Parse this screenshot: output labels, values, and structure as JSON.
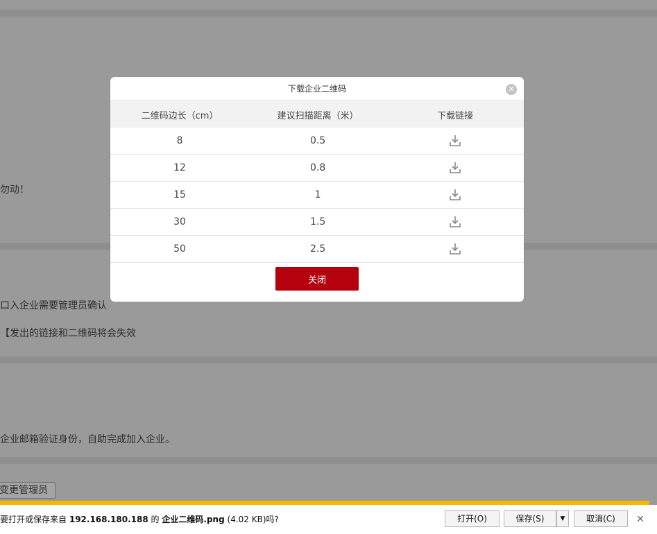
{
  "background": {
    "text_notice": "勿动！",
    "text_confirm": "口入企业需要管理员确认",
    "text_invalid": "【发出的链接和二维码将会失效",
    "text_email": "企业邮箱验证身份，自助完成加入企业。",
    "change_admin_button": "变更管理员"
  },
  "modal": {
    "title": "下载企业二维码",
    "close_icon": "close-circle-icon",
    "headers": [
      "二维码边长（cm）",
      "建议扫描距离（米）",
      "下载链接"
    ],
    "rows": [
      {
        "size": "8",
        "distance": "0.5"
      },
      {
        "size": "12",
        "distance": "0.8"
      },
      {
        "size": "15",
        "distance": "1"
      },
      {
        "size": "30",
        "distance": "1.5"
      },
      {
        "size": "50",
        "distance": "2.5"
      }
    ],
    "download_icon": "download-icon",
    "close_button": "关闭"
  },
  "download_bar": {
    "msg_prefix": "要打开或保存来自",
    "host": "192.168.180.188",
    "msg_mid": "的",
    "filename": "企业二维码.png",
    "size": "(4.02 KB)",
    "msg_suffix": "吗?",
    "open_button": "打开(O)",
    "save_button": "保存(S)",
    "cancel_button": "取消(C)",
    "dropdown_icon": "triangle-down-icon",
    "dismiss_icon": "close-icon"
  },
  "colors": {
    "accent_red": "#b5000d",
    "overlay": "#9a9a9a",
    "bar_yellow": "#f5b800"
  }
}
